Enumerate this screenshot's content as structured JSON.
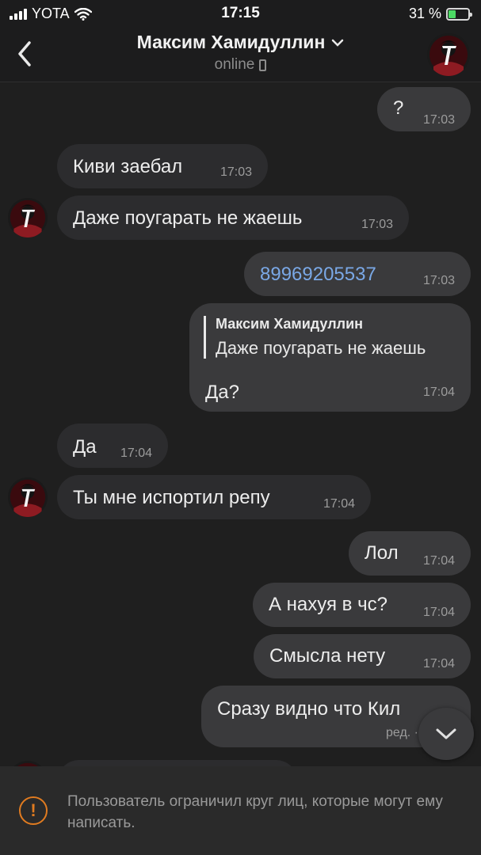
{
  "status_bar": {
    "carrier": "YOTA",
    "time": "17:15",
    "battery": "31 %",
    "battery_level": 0.31
  },
  "header": {
    "name": "Максим Хамидуллин",
    "status": "online"
  },
  "messages": [
    {
      "direction": "out",
      "text": "?",
      "time": "17:03"
    },
    {
      "direction": "in",
      "text": "Киви заебал",
      "time": "17:03"
    },
    {
      "direction": "in",
      "text": "Даже поугарать не жаешь",
      "time": "17:03",
      "avatar": true
    },
    {
      "direction": "out",
      "text": "89969205537",
      "time": "17:03",
      "is_link": true
    },
    {
      "direction": "out",
      "text": "Да?",
      "time": "17:04",
      "reply": {
        "author": "Максим Хамидуллин",
        "text": "Даже поугарать не жаешь"
      }
    },
    {
      "direction": "in",
      "text": "Да",
      "time": "17:04"
    },
    {
      "direction": "in",
      "text": "Ты мне испортил репу",
      "time": "17:04",
      "avatar": true
    },
    {
      "direction": "out",
      "text": "Лол",
      "time": "17:04"
    },
    {
      "direction": "out",
      "text": "А нахуя в чс?",
      "time": "17:04"
    },
    {
      "direction": "out",
      "text": "Смысла нету",
      "time": "17:04"
    },
    {
      "direction": "out",
      "text": "Сразу видно что Кил",
      "time": "ред. ·",
      "edited": true
    }
  ],
  "notice": {
    "text": "Пользователь ограничил круг лиц, которые могут ему написать."
  },
  "icons": {
    "back": "chevron-left-icon",
    "title_dropdown": "chevron-down-icon",
    "device": "phone-icon",
    "warning": "exclamation-circle-icon",
    "scroll_down": "chevron-down-icon"
  },
  "colors": {
    "background": "#1f1f1f",
    "bubble_in": "#2c2c2e",
    "bubble_out": "#3a3a3c",
    "link": "#7aa8e6",
    "warning": "#e07b20"
  }
}
